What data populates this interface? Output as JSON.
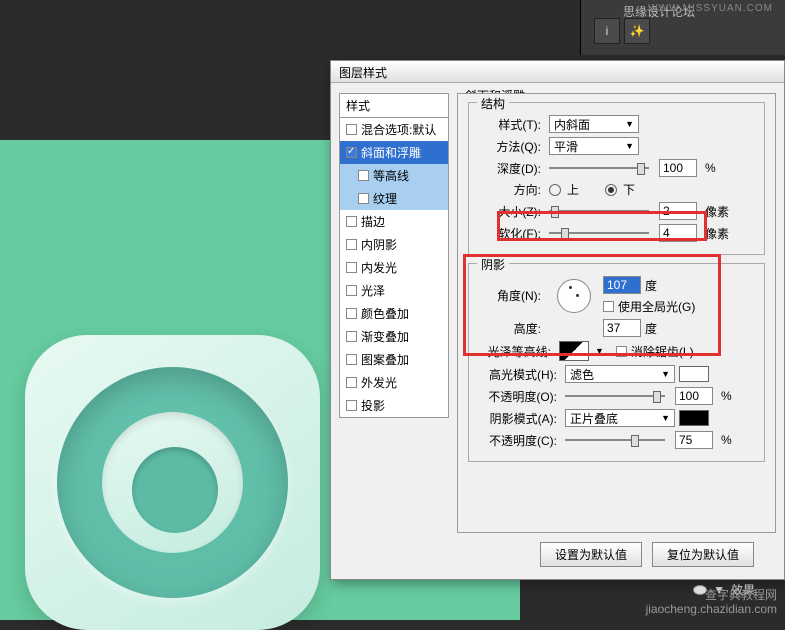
{
  "top": {
    "label": "思缘设计论坛",
    "watermark": "WWW.MISSYUAN.COM",
    "iconInfo": "i",
    "iconWand": "✨"
  },
  "dialog": {
    "title": "图层样式",
    "sidebar": {
      "head": "样式",
      "items": [
        {
          "label": "混合选项:默认"
        },
        {
          "label": "斜面和浮雕",
          "checked": true,
          "sel": true
        },
        {
          "label": "等高线",
          "sub": true,
          "sellight": true
        },
        {
          "label": "纹理",
          "sub": true,
          "sellight": true
        },
        {
          "label": "描边"
        },
        {
          "label": "内阴影"
        },
        {
          "label": "内发光"
        },
        {
          "label": "光泽"
        },
        {
          "label": "颜色叠加"
        },
        {
          "label": "渐变叠加"
        },
        {
          "label": "图案叠加"
        },
        {
          "label": "外发光"
        },
        {
          "label": "投影"
        }
      ]
    },
    "section": "斜面和浮雕",
    "structure": {
      "legend": "结构",
      "styleLabel": "样式(T):",
      "styleValue": "内斜面",
      "methodLabel": "方法(Q):",
      "methodValue": "平滑",
      "depthLabel": "深度(D):",
      "depthValue": "100",
      "depthUnit": "%",
      "dirLabel": "方向:",
      "dirUp": "上",
      "dirDown": "下",
      "sizeLabel": "大小(Z):",
      "sizeValue": "2",
      "sizeUnit": "像素",
      "softLabel": "软化(F):",
      "softValue": "4",
      "softUnit": "像素"
    },
    "shadow": {
      "legend": "阴影",
      "angleLabel": "角度(N):",
      "angleValue": "107",
      "angleUnit": "度",
      "globalLabel": "使用全局光(G)",
      "heightLabel": "高度:",
      "heightValue": "37",
      "heightUnit": "度",
      "glossLabel": "光泽等高线:",
      "antiLabel": "消除锯齿(L)",
      "hiLabel": "高光模式(H):",
      "hiValue": "滤色",
      "hiOpLabel": "不透明度(O):",
      "hiOpValue": "100",
      "hiOpUnit": "%",
      "shLabel": "阴影模式(A):",
      "shValue": "正片叠底",
      "shOpLabel": "不透明度(C):",
      "shOpValue": "75",
      "shOpUnit": "%"
    },
    "btnDefault": "设置为默认值",
    "btnReset": "复位为默认值"
  },
  "fx": {
    "label": "效果"
  },
  "watermark": {
    "line1": "查字典教程网",
    "line2": "jiaocheng.chazidian.com"
  }
}
